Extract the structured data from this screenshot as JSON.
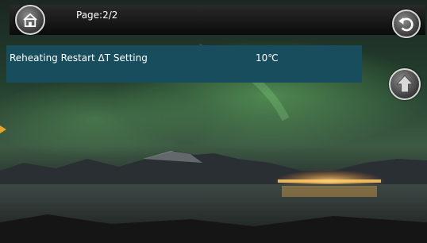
{
  "header": {
    "page_label": "Page:2/2"
  },
  "icons": {
    "home": "home-icon",
    "back": "back-arrow-icon",
    "up": "up-arrow-icon"
  },
  "settings": [
    {
      "name": "Reheating Restart ΔT Setting",
      "value": "10℃"
    }
  ],
  "colors": {
    "row_background": "#174d5d",
    "topbar": "#111111",
    "side_arrow": "#e8a227"
  }
}
